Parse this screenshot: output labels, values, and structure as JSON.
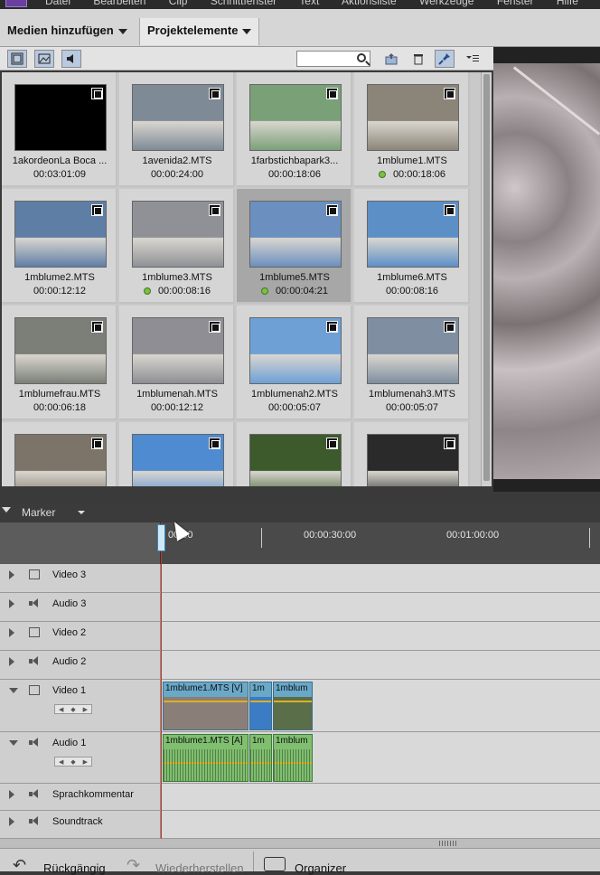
{
  "menubar": {
    "items": [
      "Datei",
      "Bearbeiten",
      "Clip",
      "Schnittfenster",
      "Text",
      "Aktionsliste",
      "Werkzeuge",
      "Fenster",
      "Hilfe"
    ]
  },
  "tabs": [
    {
      "label": "Medien hinzufügen"
    },
    {
      "label": "Projektelemente"
    }
  ],
  "toolbar": {
    "search_value": "",
    "icons": [
      "video-filter-icon",
      "image-filter-icon",
      "audio-filter-icon",
      "new-item-icon",
      "trash-icon",
      "pin-icon",
      "list-menu-icon"
    ]
  },
  "media": [
    {
      "name": "1akordeonLa Boca ...",
      "duration": "00:03:01:09",
      "used": false,
      "thumb": "#000000"
    },
    {
      "name": "1avenida2.MTS",
      "duration": "00:00:24:00",
      "used": false,
      "thumb": "#7e8a96"
    },
    {
      "name": "1farbstichbapark3...",
      "duration": "00:00:18:06",
      "used": false,
      "thumb": "#7aa078"
    },
    {
      "name": "1mblume1.MTS",
      "duration": "00:00:18:06",
      "used": true,
      "thumb": "#8b8478"
    },
    {
      "name": "1mblume2.MTS",
      "duration": "00:00:12:12",
      "used": false,
      "thumb": "#5f7ea6"
    },
    {
      "name": "1mblume3.MTS",
      "duration": "00:00:08:16",
      "used": true,
      "thumb": "#8f9196"
    },
    {
      "name": "1mblume5.MTS",
      "duration": "00:00:04:21",
      "used": true,
      "thumb": "#6b8fbf"
    },
    {
      "name": "1mblume6.MTS",
      "duration": "00:00:08:16",
      "used": false,
      "thumb": "#5d8fc7"
    },
    {
      "name": "1mblumefrau.MTS",
      "duration": "00:00:06:18",
      "used": false,
      "thumb": "#7b7f77"
    },
    {
      "name": "1mblumenah.MTS",
      "duration": "00:00:12:12",
      "used": false,
      "thumb": "#8e8e94"
    },
    {
      "name": "1mblumenah2.MTS",
      "duration": "00:00:05:07",
      "used": false,
      "thumb": "#6ea0d6"
    },
    {
      "name": "1mblumenah3.MTS",
      "duration": "00:00:05:07",
      "used": false,
      "thumb": "#7f8ea0"
    },
    {
      "name": "",
      "duration": "",
      "used": false,
      "thumb": "#7c7468"
    },
    {
      "name": "",
      "duration": "",
      "used": false,
      "thumb": "#4f8bd0"
    },
    {
      "name": "",
      "duration": "",
      "used": false,
      "thumb": "#3c5a2c"
    },
    {
      "name": "",
      "duration": "",
      "used": false,
      "thumb": "#2a2a2a"
    }
  ],
  "timeline": {
    "marker_label": "Marker",
    "ruler": [
      "00:00",
      "00:00:30:00",
      "00:01:00:00"
    ],
    "tracks": [
      {
        "name": "Video 3",
        "kind": "video",
        "open": false
      },
      {
        "name": "Audio 3",
        "kind": "audio",
        "open": false
      },
      {
        "name": "Video 2",
        "kind": "video",
        "open": false
      },
      {
        "name": "Audio 2",
        "kind": "audio",
        "open": false
      },
      {
        "name": "Video 1",
        "kind": "video",
        "open": true
      },
      {
        "name": "Audio 1",
        "kind": "audio",
        "open": true
      },
      {
        "name": "Sprachkommentar",
        "kind": "mic",
        "open": false
      },
      {
        "name": "Soundtrack",
        "kind": "music",
        "open": false
      }
    ],
    "video_clips": [
      "1mblume1.MTS [V]",
      "1m",
      "1mblum"
    ],
    "audio_clips": [
      "1mblume1.MTS [A]",
      "1m",
      "1mblum"
    ]
  },
  "bottombar": {
    "undo": "Rückgängig",
    "redo": "Wiederherstellen",
    "organizer": "Organizer"
  }
}
